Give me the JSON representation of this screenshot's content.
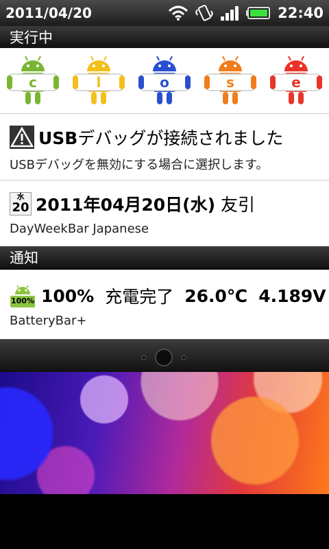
{
  "status_bar": {
    "date": "2011/04/20",
    "time": "22:40",
    "icons": [
      "wifi-icon",
      "vibrate-icon",
      "signal-icon",
      "battery-icon"
    ]
  },
  "sections": {
    "running_header": "実行中",
    "notifications_header": "通知"
  },
  "running_apps": [
    {
      "name": "c",
      "letter": "c",
      "color": "#7ab532"
    },
    {
      "name": "l",
      "letter": "l",
      "color": "#f2c01c"
    },
    {
      "name": "o",
      "letter": "o",
      "color": "#2a4fd0"
    },
    {
      "name": "s",
      "letter": "s",
      "color": "#f07d1e"
    },
    {
      "name": "e",
      "letter": "e",
      "color": "#e8342a"
    }
  ],
  "ongoing": [
    {
      "icon": "usb-warning-icon",
      "title_bold": "USB",
      "title_rest": "デバッグが接続されました",
      "subtitle": "USBデバッグを無効にする場合に選択します。"
    },
    {
      "icon": "calendar-icon",
      "icon_top": "水",
      "icon_day": "20",
      "title_bold": "2011年04月20日(水)",
      "title_rest": " 友引",
      "subtitle": "DayWeekBar Japanese"
    }
  ],
  "notifications": [
    {
      "icon": "android-battery-icon",
      "icon_label": "100%",
      "title_bold": "100%",
      "title_rest": "充電完了",
      "title_temp": "26.0℃",
      "title_volt": "4.189V",
      "subtitle": "BatteryBar+"
    }
  ]
}
